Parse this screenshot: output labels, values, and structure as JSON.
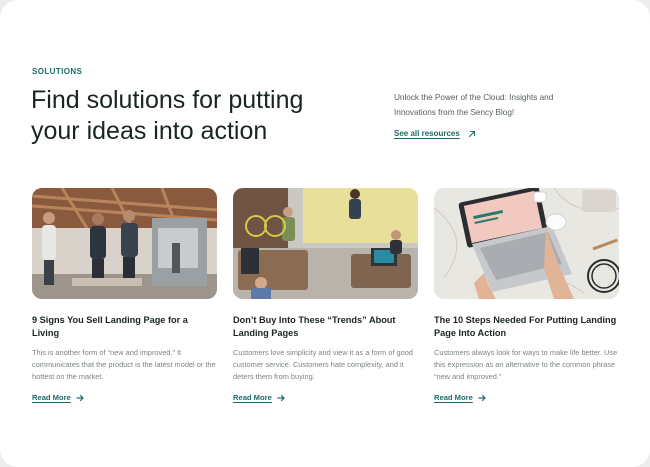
{
  "section": {
    "eyebrow": "SOLUTIONS",
    "headline_line1": "Find solutions for putting",
    "headline_line2": "your ideas into action",
    "intro": "Unlock the Power of the Cloud: Insights and Innovations from the Sency Blog!",
    "see_all_label": "See all resources",
    "see_all_icon": "arrow-up-right-icon"
  },
  "cards": [
    {
      "title": "9 Signs You Sell Landing Page for a Living",
      "body": "This is another form of “new and improved.” It communicates that the product is the latest model or the hottest on the market.",
      "link_label": "Read More",
      "image": "workshop-team-photo"
    },
    {
      "title": "Don’t Buy Into These “Trends” About Landing Pages",
      "body": "Customers love simplicity and view it as a form of good customer service. Customers hate complexity, and it deters them from buying.",
      "link_label": "Read More",
      "image": "office-overhead-photo"
    },
    {
      "title": "The 10 Steps Needed For Putting Landing Page Into Action",
      "body": "Customers always look for ways to make life better. Use this expression as an alternative to the common phrase “new and improved.”",
      "link_label": "Read More",
      "image": "laptop-desk-photo"
    }
  ],
  "colors": {
    "accent": "#1f6b66",
    "heading": "#1a2424",
    "muted": "#7b8484"
  }
}
